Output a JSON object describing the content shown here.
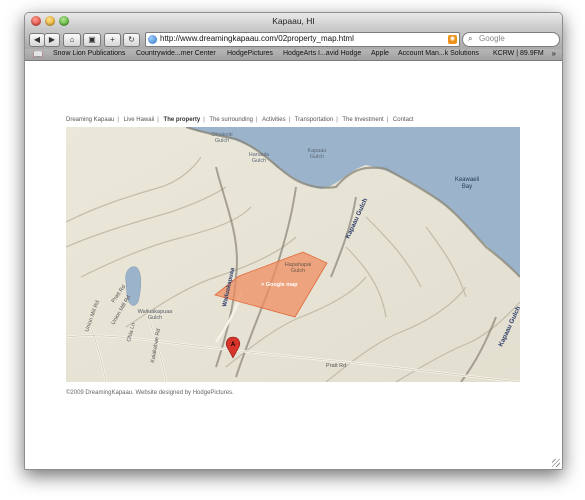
{
  "window": {
    "title": "Kapaau, HI"
  },
  "toolbar": {
    "back_icon": "back-arrow-icon",
    "forward_icon": "forward-arrow-icon",
    "home_icon": "home-icon",
    "image_icon": "image-icon",
    "add_bookmark_icon": "plus-icon",
    "reload_icon": "reload-icon",
    "url": "http://www.dreamingkapaau.com/02property_map.html",
    "search_placeholder": "Google"
  },
  "bookmarks": [
    "Snow Lion Publications",
    "Countrywide...mer Center",
    "HodgePictures",
    "HodgeArts I...avid Hodge",
    "Apple",
    "Account Man...k Solutions",
    "KCRW | 89.9FM"
  ],
  "nav": {
    "items": [
      "Dreaming Kapaau",
      "Live Hawaii",
      "The property",
      "The surrounding",
      "Activities",
      "Transportation",
      "The Investment",
      "Contact"
    ],
    "active_index": 2
  },
  "map": {
    "labels": {
      "ohiakole_gulch": "Ohiakole\nGulch",
      "hanaula_gulch": "Hanaula\nGulch",
      "kapaau_gulch_top": "Kapaau\nGulch",
      "keawaeli_bay": "Keawaeli\nBay",
      "kapaau_gulch_road": "Kapaau Gulch",
      "hapahapai_gulch": "Hapahapai\nGulch",
      "wailuakapuaa_gulch": "Wailuakapuaa\nGulch",
      "pratt_rd_1": "Pratt Rd",
      "pratt_rd_2": "Pratt Rd",
      "union_mill_rd_1": "Union Mill Rd",
      "union_mill_rd_2": "Union Mill Rd",
      "ohia_ln": "Ohia Ln",
      "kaiakahae_rd": "Kaiakahae Rd",
      "google_map_link": "> Google map",
      "marker": "A"
    },
    "colors": {
      "ocean": "#9bb3cb",
      "land": "#e8e4d6",
      "overlay": "#f08a5d"
    }
  },
  "footer": "©2009 DreamingKapaau. Website designed by HodgePictures."
}
